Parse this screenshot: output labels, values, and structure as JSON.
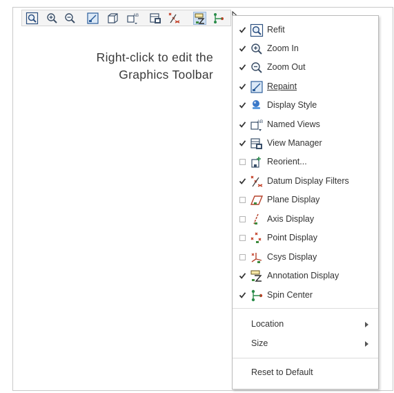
{
  "caption": {
    "line1": "Right-click to edit the",
    "line2": "Graphics Toolbar"
  },
  "toolbar": {
    "buttons": [
      {
        "name": "refit",
        "icon": "refit-icon"
      },
      {
        "name": "zoom-in",
        "icon": "zoom-in-icon"
      },
      {
        "name": "zoom-out",
        "icon": "zoom-out-icon"
      },
      {
        "name": "repaint",
        "icon": "repaint-icon"
      },
      {
        "name": "display-style",
        "icon": "display-style-icon"
      },
      {
        "name": "named-views",
        "icon": "named-views-icon"
      },
      {
        "name": "view-manager",
        "icon": "view-manager-icon"
      },
      {
        "name": "datum-display-filters",
        "icon": "datum-display-filters-icon"
      },
      {
        "name": "annotation-display",
        "icon": "annotation-display-icon",
        "active": true
      },
      {
        "name": "spin-center",
        "icon": "spin-center-icon"
      }
    ]
  },
  "menu": {
    "items": [
      {
        "label": "Refit",
        "checked": true,
        "icon": "refit-icon"
      },
      {
        "label": "Zoom In",
        "checked": true,
        "icon": "zoom-in-icon"
      },
      {
        "label": "Zoom Out",
        "checked": true,
        "icon": "zoom-out-icon"
      },
      {
        "label": "Repaint",
        "checked": true,
        "icon": "repaint-icon",
        "underline": "full"
      },
      {
        "label": "Display Style",
        "checked": true,
        "icon": "display-style-icon"
      },
      {
        "label": "Named Views",
        "checked": true,
        "icon": "named-views-icon"
      },
      {
        "label": "View Manager",
        "checked": true,
        "icon": "view-manager-icon"
      },
      {
        "label": "Reorient...",
        "checked": false,
        "icon": "reorient-icon"
      },
      {
        "label": "Datum Display Filters",
        "checked": true,
        "icon": "datum-display-filters-icon"
      },
      {
        "label": "Plane Display",
        "checked": false,
        "icon": "plane-display-icon"
      },
      {
        "label": "Axis Display",
        "checked": false,
        "icon": "axis-display-icon"
      },
      {
        "label": "Point Display",
        "checked": false,
        "icon": "point-display-icon"
      },
      {
        "label": "Csys Display",
        "checked": false,
        "icon": "csys-display-icon"
      },
      {
        "label": "Annotation Display",
        "checked": true,
        "icon": "annotation-display-icon"
      },
      {
        "label": "Spin Center",
        "checked": true,
        "icon": "spin-center-icon"
      }
    ],
    "location_label": "Location",
    "size_label": "Size",
    "reset_label": "Reset to Default"
  }
}
